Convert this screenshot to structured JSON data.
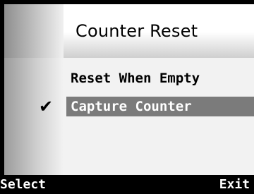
{
  "screen": {
    "title": "Counter Reset"
  },
  "menu": {
    "items": [
      {
        "label": "Reset When Empty",
        "selected": false,
        "checked": false
      },
      {
        "label": "Capture Counter",
        "selected": true,
        "checked": true
      }
    ],
    "check_icon": "check-icon"
  },
  "softkeys": {
    "left": "Select",
    "right": "Exit"
  },
  "colors": {
    "selection": "#7b7b7b",
    "background": "#f2f2f2",
    "frame": "#000000"
  }
}
